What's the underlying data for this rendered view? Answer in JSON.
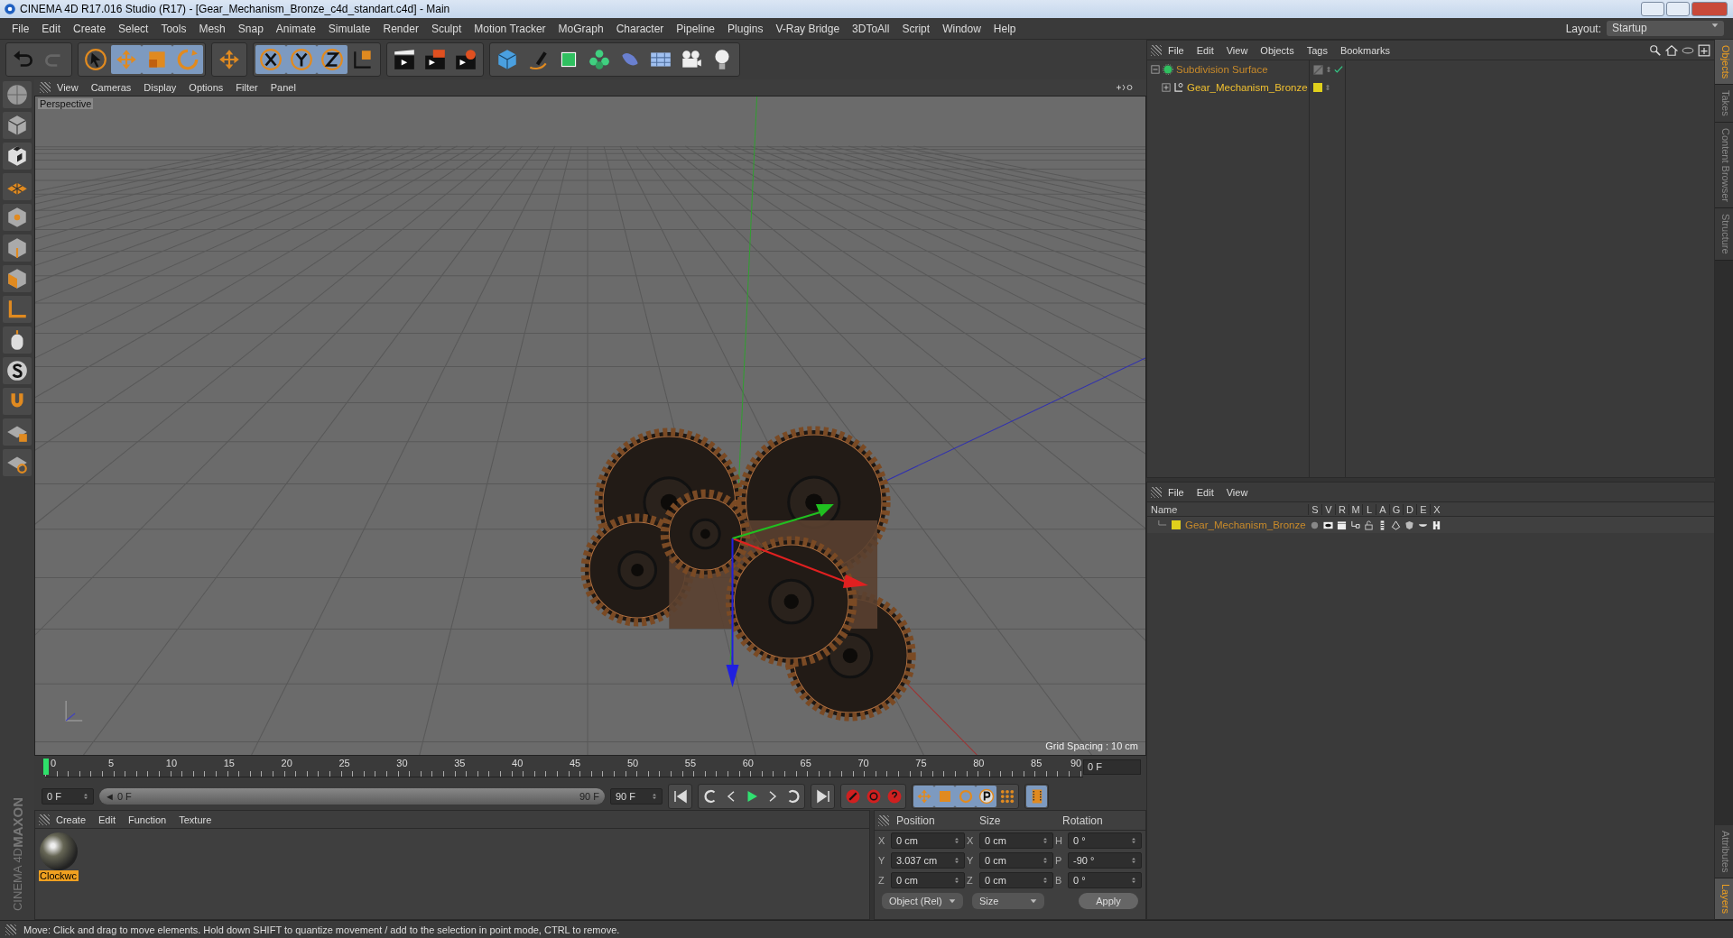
{
  "window": {
    "title": "CINEMA 4D R17.016 Studio (R17) - [Gear_Mechanism_Bronze_c4d_standart.c4d] - Main"
  },
  "menu_bar": {
    "items": [
      "File",
      "Edit",
      "Create",
      "Select",
      "Tools",
      "Mesh",
      "Snap",
      "Animate",
      "Simulate",
      "Render",
      "Sculpt",
      "Motion Tracker",
      "MoGraph",
      "Character",
      "Pipeline",
      "Plugins",
      "V-Ray Bridge",
      "3DToAll",
      "Script",
      "Window",
      "Help"
    ],
    "layout_label": "Layout:",
    "layout_value": "Startup"
  },
  "viewport": {
    "menu": [
      "View",
      "Cameras",
      "Display",
      "Options",
      "Filter",
      "Panel"
    ],
    "camera_label": "Perspective",
    "grid_spacing": "Grid Spacing : 10 cm"
  },
  "timeline": {
    "ticks": [
      "0",
      "5",
      "10",
      "15",
      "20",
      "25",
      "30",
      "35",
      "40",
      "45",
      "50",
      "55",
      "60",
      "65",
      "70",
      "75",
      "80",
      "85",
      "90"
    ],
    "current_frame": "0 F",
    "start_field": "0 F",
    "range": {
      "start": "◄ 0 F",
      "end": "90 F",
      "level": 1
    },
    "end_field": "90 F",
    "playhead": {
      "level": 0
    }
  },
  "material_manager": {
    "menu": [
      "Create",
      "Edit",
      "Function",
      "Texture"
    ],
    "materials": [
      {
        "name": "Clockwc",
        "selected": true
      }
    ]
  },
  "coordinates": {
    "headers": [
      "Position",
      "Size",
      "Rotation"
    ],
    "rows": [
      {
        "pos_axis": "X",
        "position": "0 cm",
        "size_axis": "X",
        "size": "0 cm",
        "rot_axis": "H",
        "rotation": "0 °"
      },
      {
        "pos_axis": "Y",
        "position": "3.037 cm",
        "size_axis": "Y",
        "size": "0 cm",
        "rot_axis": "P",
        "rotation": "-90 °"
      },
      {
        "pos_axis": "Z",
        "position": "0 cm",
        "size_axis": "Z",
        "size": "0 cm",
        "rot_axis": "B",
        "rotation": "0 °"
      }
    ],
    "mode_dropdown": "Object (Rel)",
    "size_dropdown": "Size",
    "apply_button": "Apply"
  },
  "object_manager": {
    "menu": [
      "File",
      "Edit",
      "View",
      "Objects",
      "Tags",
      "Bookmarks"
    ],
    "objects": [
      {
        "name": "Subdivision Surface",
        "expanded": true,
        "enabled": true,
        "children": [
          {
            "name": "Gear_Mechanism_Bronze",
            "expanded": false,
            "color": "#e0d01c"
          }
        ]
      }
    ]
  },
  "layer_manager": {
    "menu": [
      "File",
      "Edit",
      "View"
    ],
    "columns": [
      "Name",
      "S",
      "V",
      "R",
      "M",
      "L",
      "A",
      "G",
      "D",
      "E",
      "X"
    ],
    "layers": [
      {
        "name": "Gear_Mechanism_Bronze",
        "color": "#e0d01c"
      }
    ]
  },
  "side_tabs": {
    "upper": [
      {
        "label": "Objects",
        "selected": true
      },
      {
        "label": "Takes",
        "selected": false
      },
      {
        "label": "Content Browser",
        "selected": false
      },
      {
        "label": "Structure",
        "selected": false
      }
    ],
    "lower": [
      {
        "label": "Attributes",
        "selected": false
      },
      {
        "label": "Layers",
        "selected": true
      }
    ]
  },
  "branding": {
    "company": "MAXON",
    "product": "CINEMA 4D"
  },
  "status_bar": {
    "text": "Move: Click and drag to move elements. Hold down SHIFT to quantize movement / add to the selection in point mode, CTRL to remove."
  }
}
